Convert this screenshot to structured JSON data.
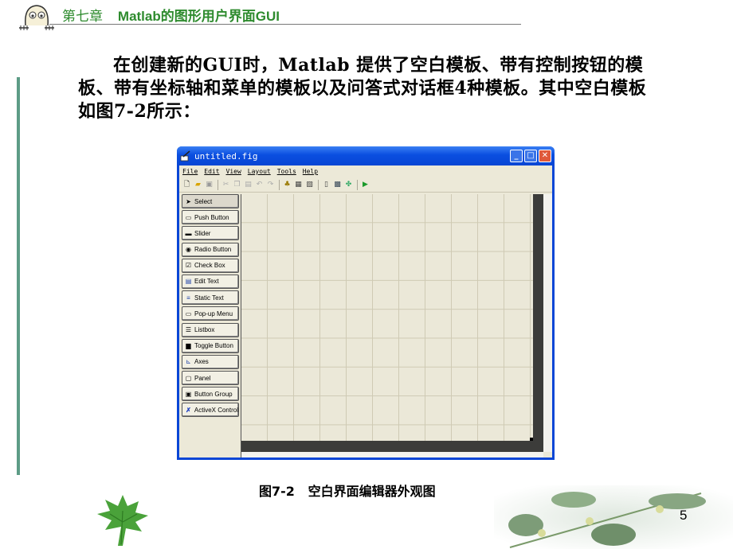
{
  "header": {
    "chapter_label": "第七章",
    "chapter_title": "Matlab的图形用户界面GUI"
  },
  "body": {
    "paragraph": "在创建新的GUI时，Matlab 提供了空白模板、带有控制按钮的模板、带有坐标轴和菜单的模板以及问答式对话框4种模板。其中空白模板如图7-2所示："
  },
  "window": {
    "title": "untitled.fig",
    "controls": [
      "minimize-icon",
      "maximize-icon",
      "close-icon"
    ],
    "menu": [
      "File",
      "Edit",
      "View",
      "Layout",
      "Tools",
      "Help"
    ],
    "toolbar": [
      "new-icon",
      "open-icon",
      "save-icon",
      "|",
      "cut-icon",
      "copy-icon",
      "paste-icon",
      "undo-icon",
      "redo-icon",
      "|",
      "align-icon",
      "menu-editor-icon",
      "tab-order-icon",
      "|",
      "mfile-editor-icon",
      "property-inspector-icon",
      "object-browser-icon",
      "|",
      "run-icon"
    ],
    "palette": [
      {
        "label": "Select",
        "icon": "arrow-icon",
        "selected": true
      },
      {
        "label": "Push Button",
        "icon": "pushbutton-icon"
      },
      {
        "label": "Slider",
        "icon": "slider-icon"
      },
      {
        "label": "Radio Button",
        "icon": "radio-icon"
      },
      {
        "label": "Check Box",
        "icon": "checkbox-icon"
      },
      {
        "label": "Edit Text",
        "icon": "edittext-icon"
      },
      {
        "label": "Static Text",
        "icon": "statictext-icon"
      },
      {
        "label": "Pop-up Menu",
        "icon": "popup-icon"
      },
      {
        "label": "Listbox",
        "icon": "listbox-icon"
      },
      {
        "label": "Toggle Button",
        "icon": "toggle-icon"
      },
      {
        "label": "Axes",
        "icon": "axes-icon"
      },
      {
        "label": "Panel",
        "icon": "panel-icon"
      },
      {
        "label": "Button Group",
        "icon": "buttongroup-icon"
      },
      {
        "label": "ActiveX Control",
        "icon": "activex-icon"
      }
    ]
  },
  "caption": "图7-2   空白界面编辑器外观图",
  "page_number": "5",
  "colors": {
    "chapter_green": "#2e8b2e",
    "side_bar": "#5d9c86",
    "xp_title_blue": "#0a46d6",
    "xp_face": "#ece9d8"
  }
}
